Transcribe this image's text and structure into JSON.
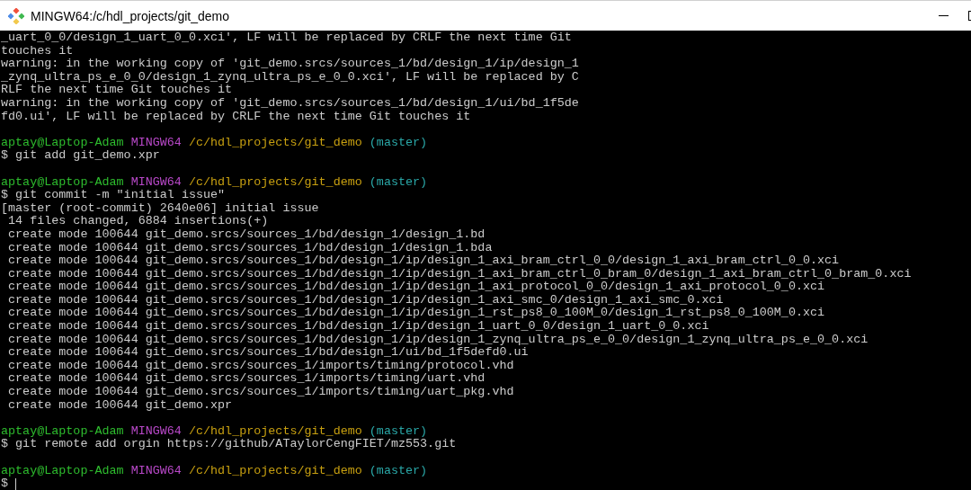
{
  "window": {
    "title": "MINGW64:/c/hdl_projects/git_demo"
  },
  "terminal": {
    "lines": [
      {
        "kind": "text",
        "text": "_uart_0_0/design_1_uart_0_0.xci', LF will be replaced by CRLF the next time Git"
      },
      {
        "kind": "text",
        "text": "touches it"
      },
      {
        "kind": "text",
        "text": "warning: in the working copy of 'git_demo.srcs/sources_1/bd/design_1/ip/design_1"
      },
      {
        "kind": "text",
        "text": "_zynq_ultra_ps_e_0_0/design_1_zynq_ultra_ps_e_0_0.xci', LF will be replaced by C"
      },
      {
        "kind": "text",
        "text": "RLF the next time Git touches it"
      },
      {
        "kind": "text",
        "text": "warning: in the working copy of 'git_demo.srcs/sources_1/bd/design_1/ui/bd_1f5de"
      },
      {
        "kind": "text",
        "text": "fd0.ui', LF will be replaced by CRLF the next time Git touches it"
      },
      {
        "kind": "blank"
      },
      {
        "kind": "prompt",
        "user": "aptay@Laptop-Adam",
        "host": "MINGW64",
        "path": "/c/hdl_projects/git_demo",
        "branch": "(master)"
      },
      {
        "kind": "text",
        "text": "$ git add git_demo.xpr"
      },
      {
        "kind": "blank"
      },
      {
        "kind": "prompt",
        "user": "aptay@Laptop-Adam",
        "host": "MINGW64",
        "path": "/c/hdl_projects/git_demo",
        "branch": "(master)"
      },
      {
        "kind": "text",
        "text": "$ git commit -m \"initial issue\""
      },
      {
        "kind": "text",
        "text": "[master (root-commit) 2640e06] initial issue"
      },
      {
        "kind": "text",
        "text": " 14 files changed, 6884 insertions(+)"
      },
      {
        "kind": "text",
        "text": " create mode 100644 git_demo.srcs/sources_1/bd/design_1/design_1.bd"
      },
      {
        "kind": "text",
        "text": " create mode 100644 git_demo.srcs/sources_1/bd/design_1/design_1.bda"
      },
      {
        "kind": "text",
        "text": " create mode 100644 git_demo.srcs/sources_1/bd/design_1/ip/design_1_axi_bram_ctrl_0_0/design_1_axi_bram_ctrl_0_0.xci"
      },
      {
        "kind": "text",
        "text": " create mode 100644 git_demo.srcs/sources_1/bd/design_1/ip/design_1_axi_bram_ctrl_0_bram_0/design_1_axi_bram_ctrl_0_bram_0.xci"
      },
      {
        "kind": "text",
        "text": " create mode 100644 git_demo.srcs/sources_1/bd/design_1/ip/design_1_axi_protocol_0_0/design_1_axi_protocol_0_0.xci"
      },
      {
        "kind": "text",
        "text": " create mode 100644 git_demo.srcs/sources_1/bd/design_1/ip/design_1_axi_smc_0/design_1_axi_smc_0.xci"
      },
      {
        "kind": "text",
        "text": " create mode 100644 git_demo.srcs/sources_1/bd/design_1/ip/design_1_rst_ps8_0_100M_0/design_1_rst_ps8_0_100M_0.xci"
      },
      {
        "kind": "text",
        "text": " create mode 100644 git_demo.srcs/sources_1/bd/design_1/ip/design_1_uart_0_0/design_1_uart_0_0.xci"
      },
      {
        "kind": "text",
        "text": " create mode 100644 git_demo.srcs/sources_1/bd/design_1/ip/design_1_zynq_ultra_ps_e_0_0/design_1_zynq_ultra_ps_e_0_0.xci"
      },
      {
        "kind": "text",
        "text": " create mode 100644 git_demo.srcs/sources_1/bd/design_1/ui/bd_1f5defd0.ui"
      },
      {
        "kind": "text",
        "text": " create mode 100644 git_demo.srcs/sources_1/imports/timing/protocol.vhd"
      },
      {
        "kind": "text",
        "text": " create mode 100644 git_demo.srcs/sources_1/imports/timing/uart.vhd"
      },
      {
        "kind": "text",
        "text": " create mode 100644 git_demo.srcs/sources_1/imports/timing/uart_pkg.vhd"
      },
      {
        "kind": "text",
        "text": " create mode 100644 git_demo.xpr"
      },
      {
        "kind": "blank"
      },
      {
        "kind": "prompt",
        "user": "aptay@Laptop-Adam",
        "host": "MINGW64",
        "path": "/c/hdl_projects/git_demo",
        "branch": "(master)"
      },
      {
        "kind": "text",
        "text": "$ git remote add orgin https://github/ATaylorCengFIET/mz553.git"
      },
      {
        "kind": "blank"
      },
      {
        "kind": "prompt",
        "user": "aptay@Laptop-Adam",
        "host": "MINGW64",
        "path": "/c/hdl_projects/git_demo",
        "branch": "(master)"
      },
      {
        "kind": "input",
        "text": "$"
      }
    ]
  }
}
